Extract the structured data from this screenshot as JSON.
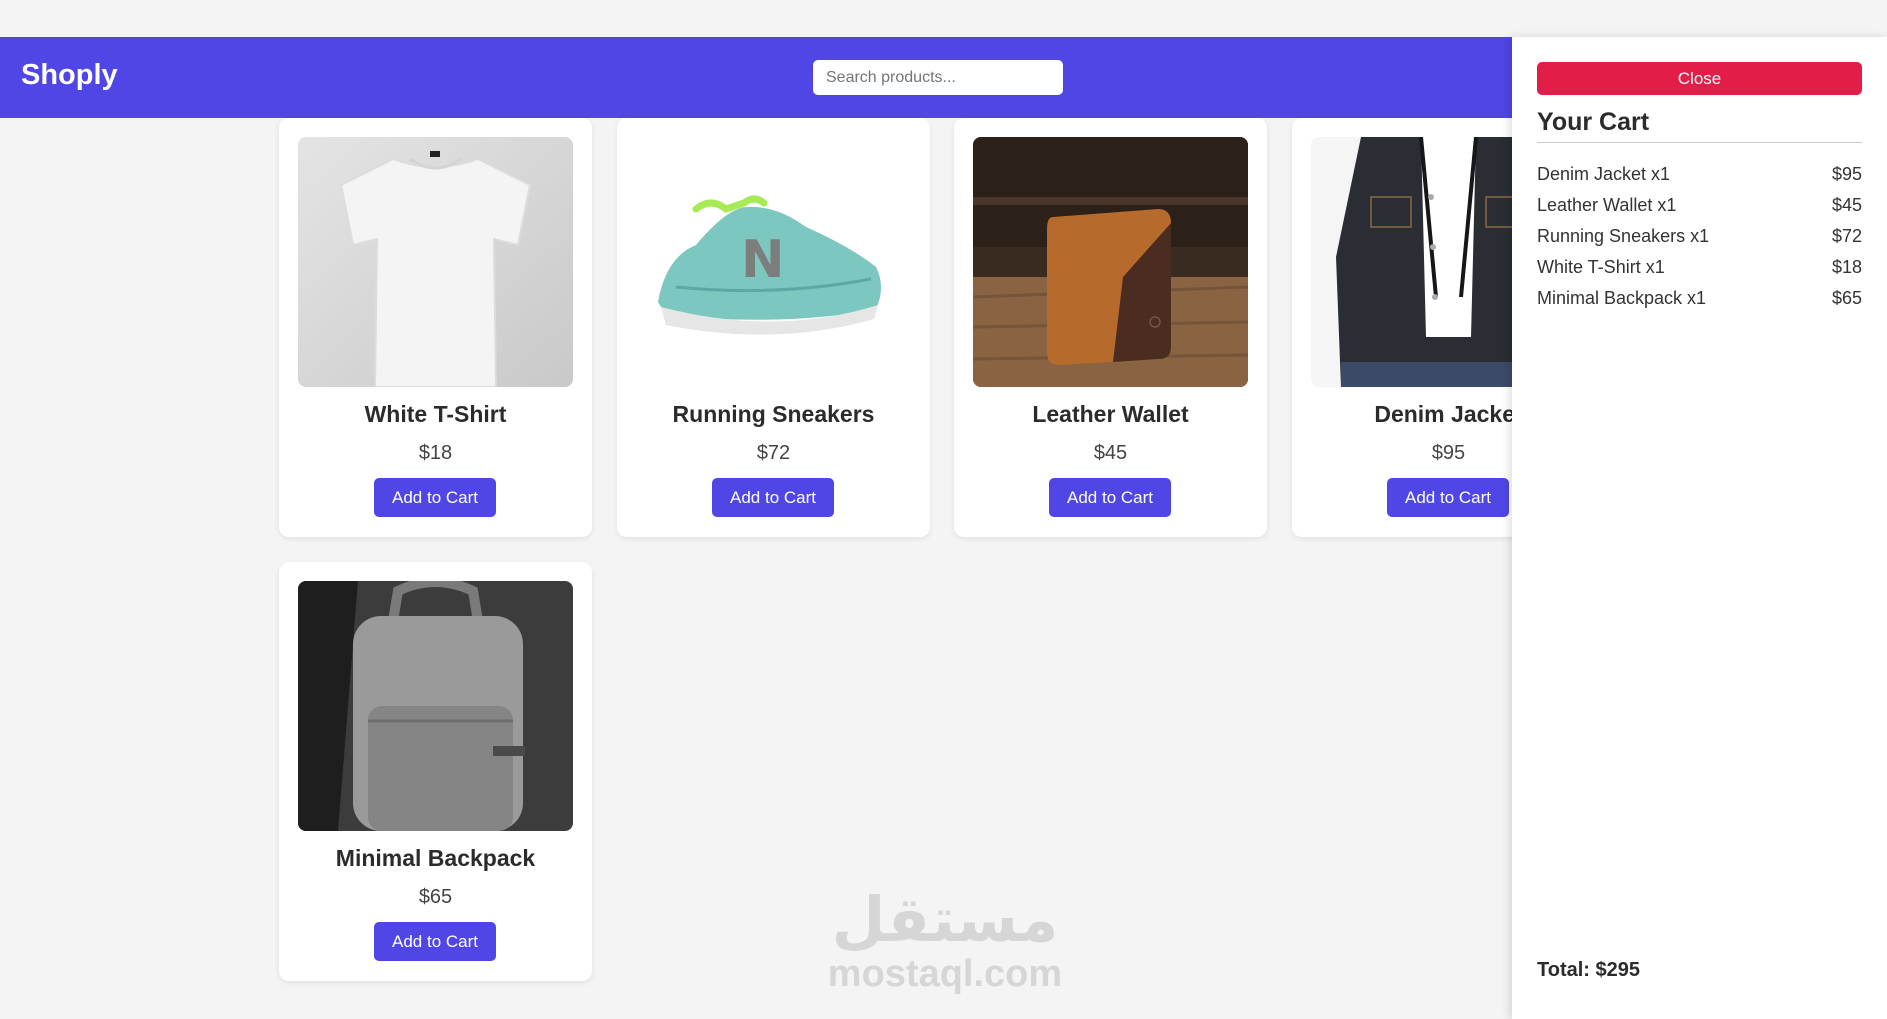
{
  "header": {
    "logo": "Shoply",
    "search_placeholder": "Search products...",
    "background_color": "#4f46e5"
  },
  "products": [
    {
      "name": "White T-Shirt",
      "price": "$18",
      "button": "Add to Cart",
      "image": "white-tshirt-image"
    },
    {
      "name": "Running Sneakers",
      "price": "$72",
      "button": "Add to Cart",
      "image": "running-sneakers-image"
    },
    {
      "name": "Leather Wallet",
      "price": "$45",
      "button": "Add to Cart",
      "image": "leather-wallet-image"
    },
    {
      "name": "Denim Jacket",
      "price": "$95",
      "button": "Add to Cart",
      "image": "denim-jacket-image"
    },
    {
      "name": "Minimal Backpack",
      "price": "$65",
      "button": "Add to Cart",
      "image": "minimal-backpack-image"
    }
  ],
  "watermark": {
    "arabic": "مستقل",
    "latin": "mostaql.com"
  },
  "cart": {
    "close_label": "Close",
    "title": "Your Cart",
    "items": [
      {
        "label": "Denim Jacket x1",
        "price": "$95"
      },
      {
        "label": "Leather Wallet x1",
        "price": "$45"
      },
      {
        "label": "Running Sneakers x1",
        "price": "$72"
      },
      {
        "label": "White T-Shirt x1",
        "price": "$18"
      },
      {
        "label": "Minimal Backpack x1",
        "price": "$65"
      }
    ],
    "total": "Total: $295",
    "close_color": "#e11d48"
  }
}
